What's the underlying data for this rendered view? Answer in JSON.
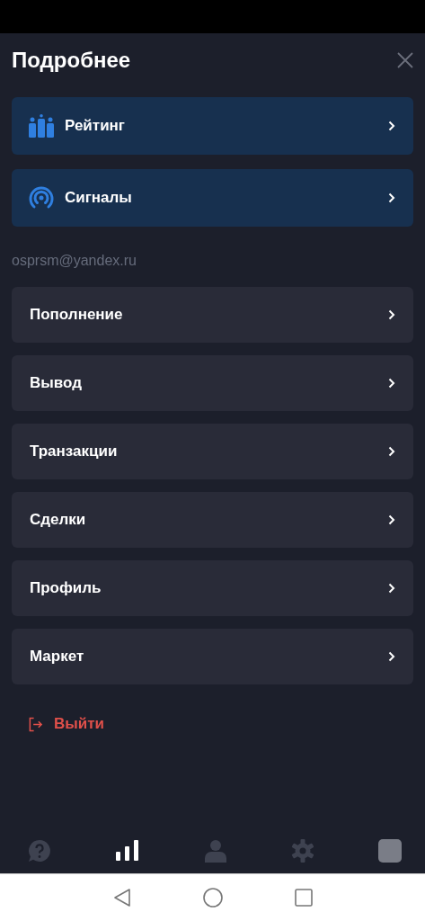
{
  "header": {
    "title": "Подробнее"
  },
  "featured": [
    {
      "label": "Рейтинг",
      "kind": "rating"
    },
    {
      "label": "Сигналы",
      "kind": "signal"
    }
  ],
  "email": "osprsm@yandex.ru",
  "menu": [
    "Пополнение",
    "Вывод",
    "Транзакции",
    "Сделки",
    "Профиль",
    "Маркет"
  ],
  "logout": "Выйти",
  "bottom_nav": [
    {
      "kind": "help",
      "selected": false
    },
    {
      "kind": "chart",
      "selected": true
    },
    {
      "kind": "user",
      "selected": false
    },
    {
      "kind": "gear",
      "selected": false
    },
    {
      "kind": "square",
      "selected": false
    }
  ]
}
